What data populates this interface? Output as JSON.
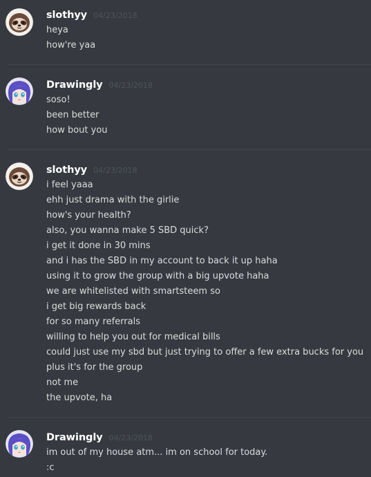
{
  "messages": [
    {
      "author": "slothyy",
      "timestamp": "04/23/2018",
      "avatar_icon": "sloth-icon",
      "lines": [
        "heya",
        "how're yaa"
      ]
    },
    {
      "author": "Drawingly",
      "timestamp": "04/23/2018",
      "avatar_icon": "anime-girl-icon",
      "lines": [
        "soso!",
        "been better",
        "how bout you"
      ]
    },
    {
      "author": "slothyy",
      "timestamp": "04/23/2018",
      "avatar_icon": "sloth-icon",
      "lines": [
        "i feel yaaa",
        "ehh just drama with the girlie",
        "how's your health?",
        "also, you wanna make 5 SBD quick?",
        "i get it done in 30 mins",
        "and i has the SBD in my account to back it up haha",
        "using it to grow the group with a big upvote haha",
        "we are whitelisted with smartsteem so",
        "i get big rewards back",
        "for so many referrals",
        "willing to help you out for medical bills",
        "could just use my sbd but just trying to offer a few extra bucks for you",
        "plus it's for the group",
        "not me",
        "the upvote, ha"
      ]
    },
    {
      "author": "Drawingly",
      "timestamp": "04/23/2018",
      "avatar_icon": "anime-girl-icon",
      "lines": [
        "im out of my house atm... im on school for today.",
        ":c"
      ]
    }
  ],
  "colors": {
    "background": "#36393f",
    "username": "#ffffff",
    "timestamp": "#4f545c",
    "text": "#dcddde",
    "divider": "#42454a"
  }
}
